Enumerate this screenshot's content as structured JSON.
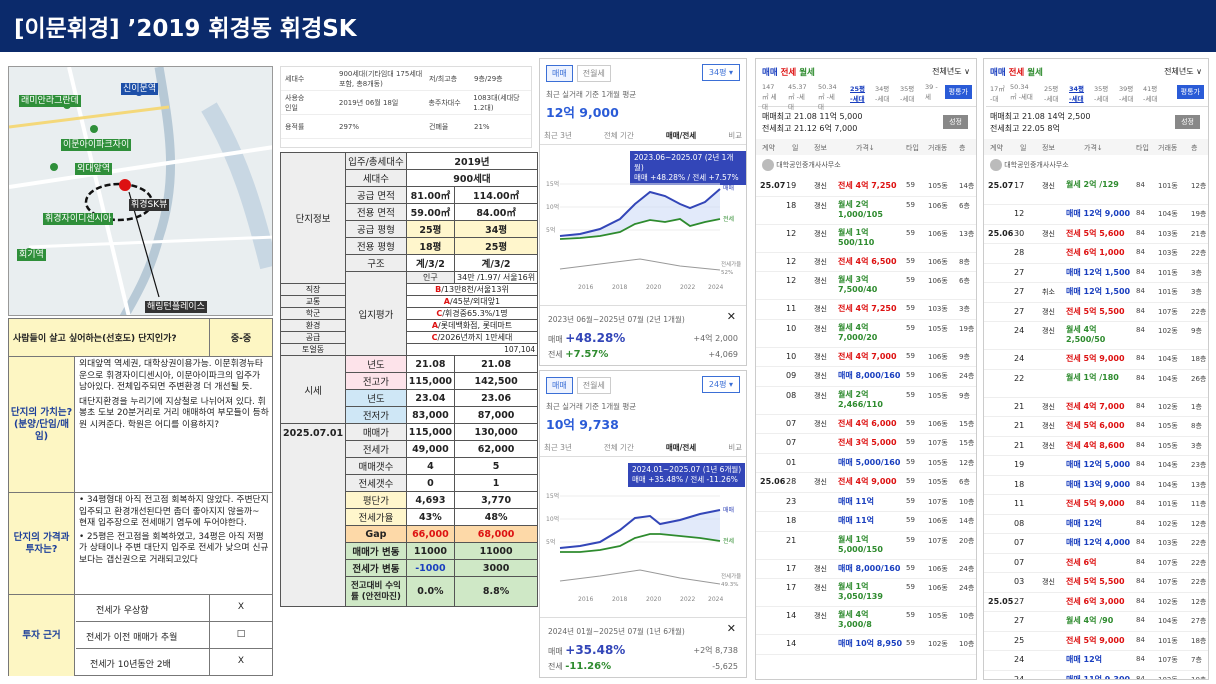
{
  "title": "[이문휘경] ’2019 휘경동 휘경SK",
  "map": {
    "labels": [
      "신이문역",
      "래미안라그란데",
      "이문아이파크자이",
      "외대앞역",
      "휘경SK뷰",
      "휘경자이디센시아",
      "회기역",
      "해링턴플레이스"
    ]
  },
  "opinion": {
    "header_q": "사람들이 살고 싶어하는(선호도) 단지인가?",
    "header_a": "중-중",
    "r1_label": "단지의 가치는? (분양/단임/매임)",
    "r1_p1": "외대앞역 역세권, 대학상권이용가능. 이문휘경뉴타운으로 휘경자이디센시아, 이문아이파크의 입주가 남아있다. 전체입주되면 주변환경 더 개선될 듯.",
    "r1_p2": "대단지환경을 누리기에 지상철로 나뉘어져 있다. 휘봉초 도보 20분거리로 거리 애매하여 부모들이 등하원 시켜준다. 학원은 어디를 이용하지?",
    "r2_label": "단지의 가격과 투자는?",
    "r2_b1": "34평형대 아직 전고점 회복하지 않았다. 주변단지 입주되고 환경개선된다면 좀더 좋아지지 않을까~ 현재 입주장으로 전세매기 염두에 두어야한다.",
    "r2_b2": "25평은 전고점을 회복하였고, 34평은 아직 저평가 상태이나 주변 대단지 입주로 전세가 낮으며 신규보다는 갭신권으로 거래되고있다",
    "r3_label": "투자 근거",
    "r3_items": [
      {
        "t": "전세가 우상향",
        "v": "X"
      },
      {
        "t": "전세가 이전 매매가 추월",
        "v": "□"
      },
      {
        "t": "전세가 10년동안 2배",
        "v": "X"
      }
    ]
  },
  "info": {
    "rows": [
      [
        "세대수",
        "900세대(기타임대 175세대 포함, 총8개동)",
        "저/최고층",
        "9층/29층"
      ],
      [
        "사용승인일",
        "2019년 06월 18일",
        "총주차대수",
        "1083대(세대당 1.2대)"
      ],
      [
        "용적률",
        "297%",
        "건폐율",
        "21%"
      ]
    ]
  },
  "complex": {
    "units_label": "입주/총세대수",
    "year": "2019년",
    "households_label": "세대수",
    "households": "900세대",
    "rows": [
      {
        "g": "단지정보",
        "k": "공급 면적",
        "a": "81.00㎡",
        "b": "114.00㎡"
      },
      {
        "k": "전용 면적",
        "a": "59.00㎡",
        "b": "84.00㎡"
      },
      {
        "k": "공급 평형",
        "a": "25평",
        "b": "34평"
      },
      {
        "k": "전용 평형",
        "a": "18평",
        "b": "25평"
      },
      {
        "k": "구조",
        "a": "계/3/2",
        "b": "계/3/2"
      }
    ],
    "loc_label": "입지평가",
    "loc": [
      {
        "k": "인구",
        "g": "",
        "v": "34만 /1.97/ 서울16위"
      },
      {
        "k": "직장",
        "g": "B",
        "v": "/13만8천/서울13위"
      },
      {
        "k": "교통",
        "g": "A",
        "v": "/45분/외대앞1"
      },
      {
        "k": "학군",
        "g": "C",
        "v": "/휘경중65.3%/1명"
      },
      {
        "k": "환경",
        "g": "A",
        "v": "/롯데백화점, 롯데마트"
      },
      {
        "k": "공급",
        "g": "C",
        "v": "/2026년까지 1만세대"
      },
      {
        "k": "토얼동",
        "g": "",
        "v": "107,104"
      }
    ],
    "price_label": "시세",
    "price": [
      {
        "k": "년도",
        "a": "21.08",
        "b": "21.08"
      },
      {
        "k": "전고가",
        "a": "115,000",
        "b": "142,500"
      },
      {
        "k": "년도",
        "a": "23.04",
        "b": "23.06"
      },
      {
        "k": "전저가",
        "a": "83,000",
        "b": "87,000"
      }
    ],
    "date": "2025.07.01",
    "cur": [
      {
        "k": "매매가",
        "a": "115,000",
        "b": "130,000"
      },
      {
        "k": "전세가",
        "a": "49,000",
        "b": "62,000"
      },
      {
        "k": "매매갯수",
        "a": "4",
        "b": "5"
      },
      {
        "k": "전세갯수",
        "a": "0",
        "b": "1"
      },
      {
        "k": "평단가",
        "a": "4,693",
        "b": "3,770"
      },
      {
        "k": "전세가율",
        "a": "43%",
        "b": "48%"
      },
      {
        "k": "Gap",
        "a": "66,000",
        "b": "68,000"
      },
      {
        "k": "매매가 변동",
        "a": "11000",
        "b": "11000"
      },
      {
        "k": "전세가 변동",
        "a": "-1000",
        "b": "3000"
      },
      {
        "k": "전고대비 수익률 (안전마진)",
        "a": "0.0%",
        "b": "8.8%"
      }
    ]
  },
  "chart1": {
    "tab1": "매매",
    "tab2": "전월세",
    "size": "34평 ▾",
    "sub": "최근 실거래 기준 1개월 평균",
    "price": "12억 9,000",
    "t1": "최근 3년",
    "t2": "전체 기간",
    "t3": "매매/전세",
    "t4": "비교",
    "tip1": "2023.06~2025.07 (2년 1개월)",
    "tip2": "매매 +48.28% / 전세 +7.57%",
    "years": [
      "2016",
      "2018",
      "2020",
      "2022",
      "2024"
    ],
    "yt": [
      "15억",
      "10억",
      "5억"
    ],
    "lg1": "매매",
    "lg2": "전세",
    "lg3": "전세가율",
    "period": "2023년 06월~2025년 07월 (2년 1개월)",
    "r1k": "매매",
    "r1v": "+48.28%",
    "r1a": "+4억 2,000",
    "r2k": "전세",
    "r2v": "+7.57%",
    "r2a": "+4,069",
    "pctlabel": "52%"
  },
  "chart2": {
    "tab1": "매매",
    "tab2": "전월세",
    "size": "24평 ▾",
    "sub": "최근 실거래 기준 1개월 평균",
    "price": "10억 9,738",
    "t1": "최근 3년",
    "t2": "전체 기간",
    "t3": "매매/전세",
    "t4": "비교",
    "tip1": "2024.01~2025.07 (1년 6개월)",
    "tip2": "매매 +35.48% / 전세 -11.26%",
    "years": [
      "2016",
      "2018",
      "2020",
      "2022",
      "2024"
    ],
    "yt": [
      "15억",
      "10억",
      "5억"
    ],
    "lg1": "매매",
    "lg2": "전세",
    "lg3": "전세가율",
    "period": "2024년 01월~2025년 07월 (1년 6개월)",
    "r1k": "매매",
    "r1v": "+35.48%",
    "r1a": "+2억 8,738",
    "r2k": "전세",
    "r2v": "-11.26%",
    "r2a": "-5,625",
    "pctlabel": "49.3%"
  },
  "list1": {
    "tabs": [
      "매매",
      "전세",
      "월세"
    ],
    "year_sel": "전체년도 ∨",
    "sizes": [
      "147㎡ 세대",
      "45.37㎡ -세대",
      "50.34㎡ -세대",
      "25평 -세대",
      "34평 -세대",
      "35평 -세대",
      "39 -세"
    ],
    "map_btn": "평통가",
    "hi1": "매매최고 21.08 11억 5,000",
    "hi2": "전세최고 21.12 6억 7,000",
    "btn2": "성정",
    "cols": [
      "계약",
      "일",
      "정보",
      "가격↓",
      "타입",
      "거래동",
      "층"
    ],
    "agent": "대학공인중개사사무소",
    "rows": [
      [
        "25.07",
        "19",
        "갱신",
        "전세 4억 7,250",
        "59",
        "105동",
        "14층"
      ],
      [
        "",
        "18",
        "갱신",
        "월세 2억 1,000/105",
        "59",
        "106동",
        "6층"
      ],
      [
        "",
        "12",
        "갱신",
        "월세 1억 500/110",
        "59",
        "106동",
        "13층"
      ],
      [
        "",
        "12",
        "갱신",
        "전세 4억 6,500",
        "59",
        "106동",
        "8층"
      ],
      [
        "",
        "12",
        "갱신",
        "월세 3억 7,500/40",
        "59",
        "106동",
        "6층"
      ],
      [
        "",
        "11",
        "갱신",
        "전세 4억 7,250",
        "59",
        "103동",
        "3층"
      ],
      [
        "",
        "10",
        "갱신",
        "월세 4억 7,000/20",
        "59",
        "105동",
        "19층"
      ],
      [
        "",
        "10",
        "갱신",
        "전세 4억 7,000",
        "59",
        "106동",
        "9층"
      ],
      [
        "",
        "09",
        "갱신",
        "매매 8,000/160",
        "59",
        "106동",
        "24층"
      ],
      [
        "",
        "08",
        "갱신",
        "월세 2억 2,466/110",
        "59",
        "105동",
        "9층"
      ],
      [
        "",
        "07",
        "갱신",
        "전세 4억 6,000",
        "59",
        "106동",
        "15층"
      ],
      [
        "",
        "07",
        "",
        "전세 3억 5,000",
        "59",
        "107동",
        "15층"
      ],
      [
        "",
        "01",
        "",
        "매매 5,000/160",
        "59",
        "105동",
        "12층"
      ],
      [
        "25.06",
        "28",
        "갱신",
        "전세 4억 9,000",
        "59",
        "105동",
        "6층"
      ],
      [
        "",
        "23",
        "",
        "매매 11억",
        "59",
        "107동",
        "10층"
      ],
      [
        "",
        "18",
        "",
        "매매 11억",
        "59",
        "106동",
        "14층"
      ],
      [
        "",
        "21",
        "",
        "월세 1억 5,000/150",
        "59",
        "107동",
        "20층"
      ],
      [
        "",
        "17",
        "갱신",
        "매매 8,000/160",
        "59",
        "106동",
        "24층"
      ],
      [
        "",
        "17",
        "갱신",
        "월세 1억 3,050/139",
        "59",
        "106동",
        "24층"
      ],
      [
        "",
        "14",
        "갱신",
        "월세 4억 3,000/8",
        "59",
        "105동",
        "10층"
      ],
      [
        "",
        "14",
        "",
        "매매 10억 8,950",
        "59",
        "102동",
        "10층"
      ]
    ]
  },
  "list2": {
    "tabs": [
      "매매",
      "전세",
      "월세"
    ],
    "year_sel": "전체년도 ∨",
    "sizes": [
      "17㎡ -대",
      "50.34㎡ -세대",
      "25평 -세대",
      "34평 -세대",
      "35평 -세대",
      "39평 -세대",
      "41평 -세대"
    ],
    "map_btn": "평통가",
    "hi1": "매매최고 21.08 14억 2,500",
    "hi2": "전세최고 22.05 8억",
    "btn2": "성정",
    "cols": [
      "계약",
      "일",
      "정보",
      "가격↓",
      "타입",
      "거래동",
      "층"
    ],
    "agent": "대학공인중개사사무소",
    "rows": [
      [
        "25.07",
        "17",
        "갱신",
        "월세 2억 /129",
        "84",
        "101동",
        "12층"
      ],
      [
        "",
        "12",
        "",
        "매매 12억 9,000",
        "84",
        "104동",
        "19층"
      ],
      [
        "25.06",
        "30",
        "갱신",
        "전세 5억 5,600",
        "84",
        "103동",
        "21층"
      ],
      [
        "",
        "28",
        "",
        "전세 6억 1,000",
        "84",
        "103동",
        "22층"
      ],
      [
        "",
        "27",
        "",
        "매매 12억 1,500",
        "84",
        "101동",
        "3층"
      ],
      [
        "",
        "27",
        "취소",
        "매매 12억 1,500",
        "84",
        "101동",
        "3층"
      ],
      [
        "",
        "27",
        "갱신",
        "전세 5억 5,500",
        "84",
        "107동",
        "22층"
      ],
      [
        "",
        "24",
        "갱신",
        "월세 4억 2,500/50",
        "84",
        "102동",
        "9층"
      ],
      [
        "",
        "24",
        "",
        "전세 5억 9,000",
        "84",
        "104동",
        "18층"
      ],
      [
        "",
        "22",
        "",
        "월세 1억 /180",
        "84",
        "104동",
        "26층"
      ],
      [
        "",
        "21",
        "갱신",
        "전세 4억 7,000",
        "84",
        "102동",
        "1층"
      ],
      [
        "",
        "21",
        "갱신",
        "전세 5억 6,000",
        "84",
        "105동",
        "8층"
      ],
      [
        "",
        "21",
        "갱신",
        "전세 4억 8,600",
        "84",
        "105동",
        "3층"
      ],
      [
        "",
        "19",
        "",
        "매매 12억 5,000",
        "84",
        "104동",
        "23층"
      ],
      [
        "",
        "18",
        "",
        "매매 13억 9,000",
        "84",
        "104동",
        "13층"
      ],
      [
        "",
        "11",
        "",
        "전세 5억 9,000",
        "84",
        "101동",
        "11층"
      ],
      [
        "",
        "08",
        "",
        "매매 12억",
        "84",
        "102동",
        "12층"
      ],
      [
        "",
        "07",
        "",
        "매매 12억 4,000",
        "84",
        "103동",
        "22층"
      ],
      [
        "",
        "07",
        "",
        "전세 6억",
        "84",
        "107동",
        "22층"
      ],
      [
        "",
        "03",
        "갱신",
        "전세 5억 5,500",
        "84",
        "107동",
        "22층"
      ],
      [
        "25.05",
        "27",
        "",
        "전세 6억 3,000",
        "84",
        "102동",
        "12층"
      ],
      [
        "",
        "27",
        "",
        "월세 4억 /90",
        "84",
        "104동",
        "27층"
      ],
      [
        "",
        "25",
        "",
        "전세 5억 9,000",
        "84",
        "101동",
        "18층"
      ],
      [
        "",
        "24",
        "",
        "매매 12억",
        "84",
        "107동",
        "7층"
      ],
      [
        "",
        "24",
        "",
        "매매 11억 9,300",
        "84",
        "102동",
        "10층"
      ]
    ]
  },
  "colors": {
    "header": "#0b2a6b",
    "buy": "#1a3fbf",
    "jeonse": "#d11",
    "wolse": "#2e8b2e"
  }
}
